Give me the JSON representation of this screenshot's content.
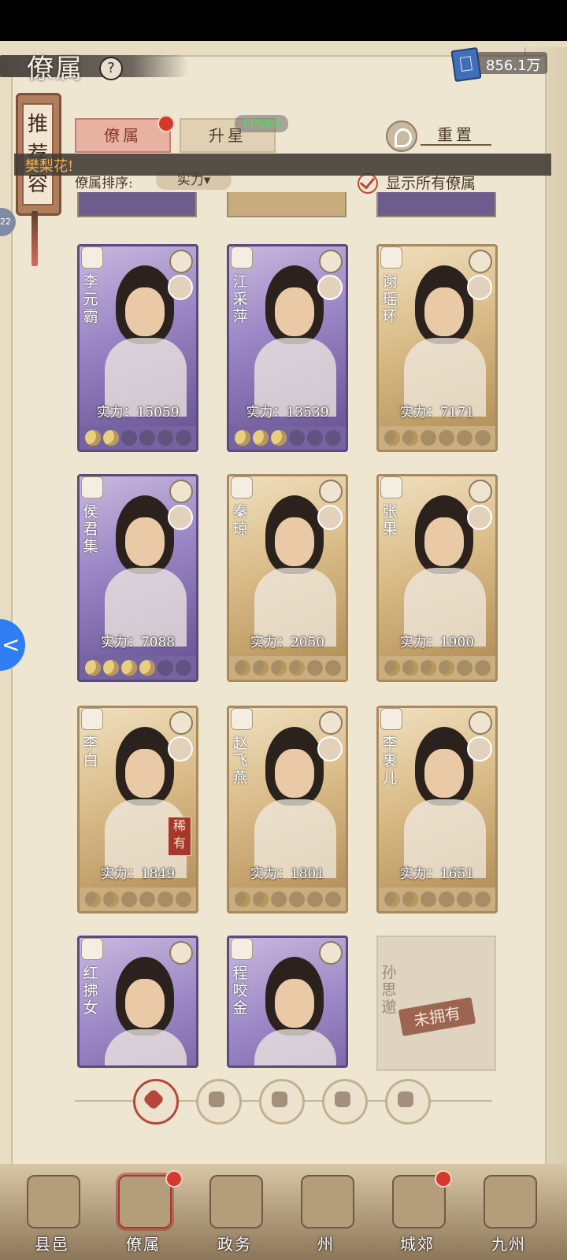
{
  "header": {
    "title": "僚属",
    "help": "?",
    "currency": "856.1万"
  },
  "side_scroll": {
    "label": "推荐容"
  },
  "tabs": [
    {
      "label": "僚属"
    },
    {
      "label": "升星"
    }
  ],
  "fps": "FPS60",
  "reset": "重置",
  "banner": "樊梨花!",
  "sort": {
    "label": "僚属排序:",
    "value": "实力▾"
  },
  "show_all": "显示所有僚属",
  "side_tag": "22",
  "cards": [
    {
      "name": "李元霸",
      "power": "实力：15059",
      "moons": 2,
      "rarity": "purple"
    },
    {
      "name": "江采萍",
      "power": "实力：13539",
      "moons": 3,
      "rarity": "purple"
    },
    {
      "name": "谢瑶环",
      "power": "实力：7171",
      "moons": 2,
      "rarity": "gold"
    },
    {
      "name": "侯君集",
      "power": "实力：7088",
      "moons": 4,
      "rarity": "purple"
    },
    {
      "name": "秦琼",
      "power": "实力：2050",
      "moons": 4,
      "rarity": "gold"
    },
    {
      "name": "张果",
      "power": "实力：1900",
      "moons": 4,
      "rarity": "gold"
    },
    {
      "name": "李白",
      "power": "实力：1849",
      "moons": 2,
      "rarity": "gold",
      "tag": "稀有"
    },
    {
      "name": "赵飞燕",
      "power": "实力：1801",
      "moons": 2,
      "rarity": "gold"
    },
    {
      "name": "李裹儿",
      "power": "实力：1651",
      "moons": 2,
      "rarity": "gold"
    },
    {
      "name": "红拂女",
      "rarity": "purple"
    },
    {
      "name": "程咬金",
      "rarity": "purple"
    },
    {
      "name": "孙思邈",
      "rarity": "locked",
      "tag": "未拥有"
    }
  ],
  "nav": [
    {
      "label": "县邑"
    },
    {
      "label": "僚属"
    },
    {
      "label": "政务"
    },
    {
      "label": "州"
    },
    {
      "label": "城郊"
    },
    {
      "label": "九州"
    }
  ]
}
